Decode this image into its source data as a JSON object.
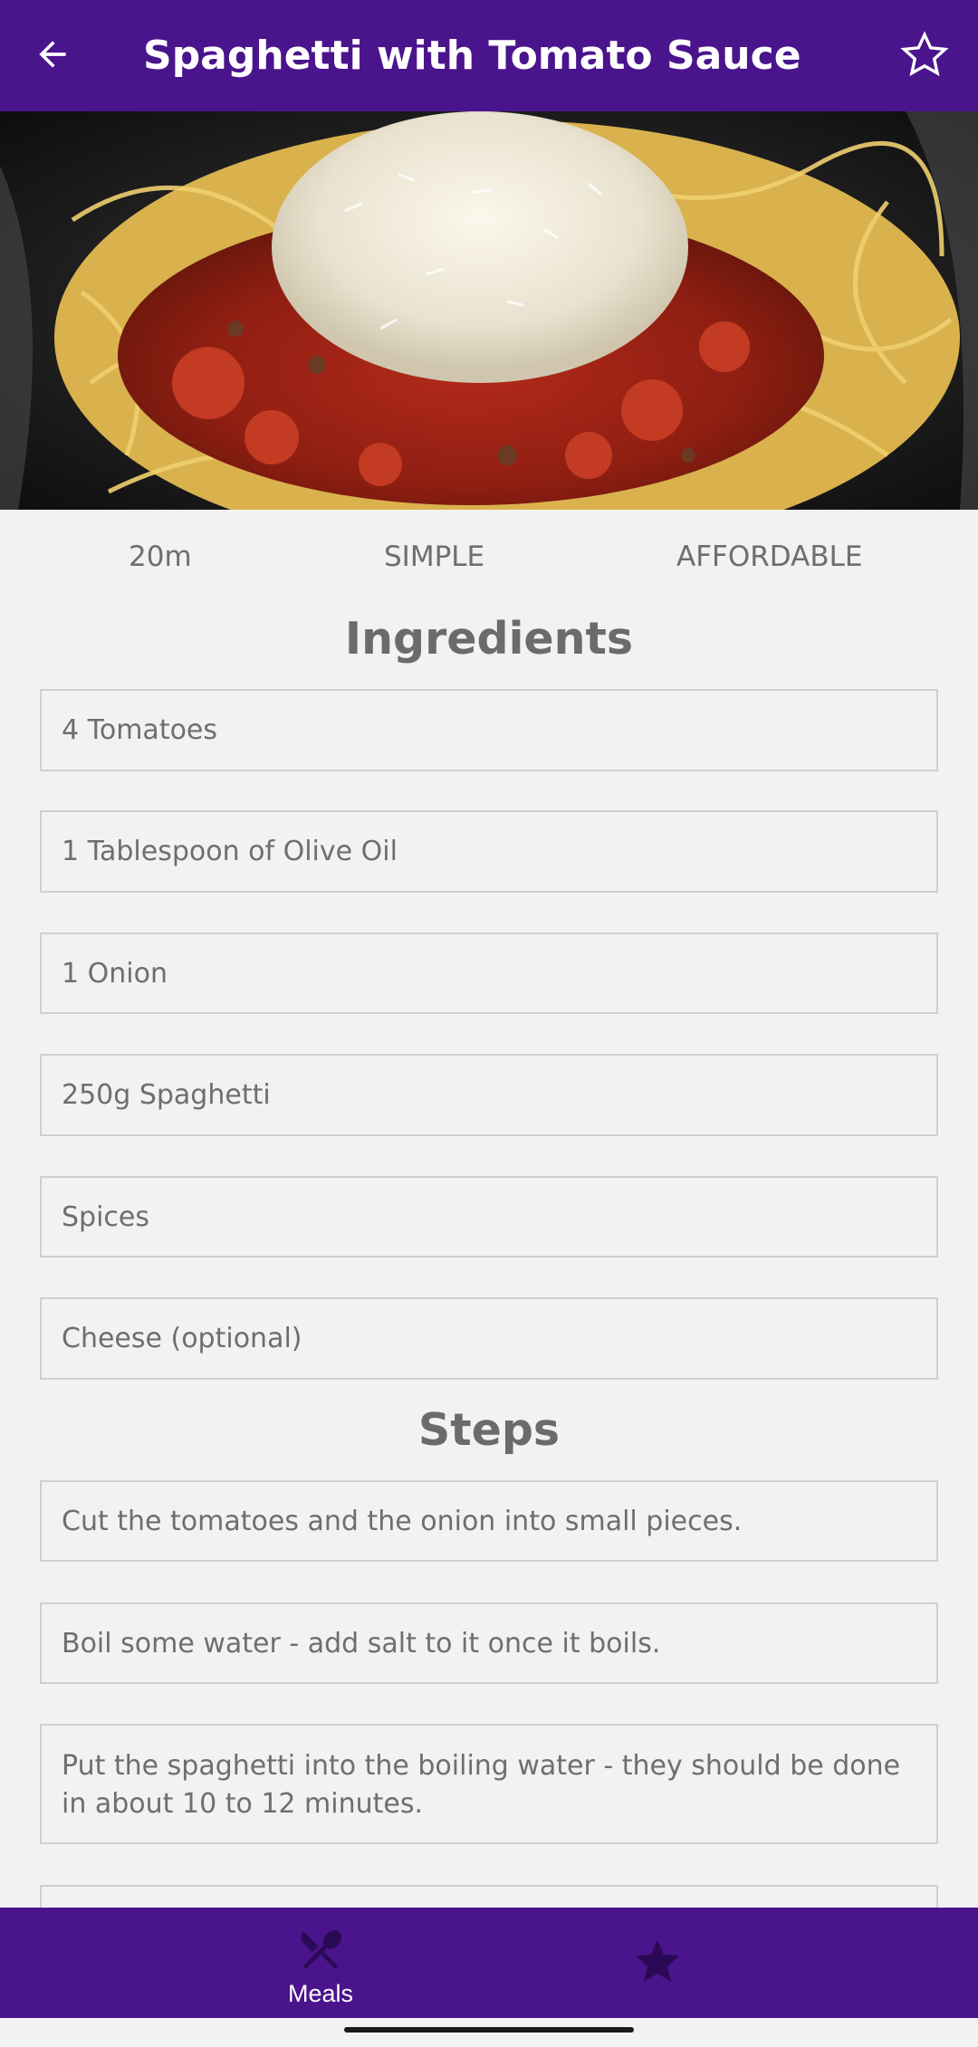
{
  "app_bar": {
    "title": "Spaghetti with Tomato Sauce",
    "back_icon": "arrow-left-icon",
    "favorite_icon": "star-outline-icon",
    "background_color": "#4a148c"
  },
  "meal": {
    "image_alt": "spaghetti-photo",
    "duration": "20m",
    "complexity": "SIMPLE",
    "affordability": "AFFORDABLE"
  },
  "ingredients_section": {
    "title": "Ingredients",
    "items": [
      "4 Tomatoes",
      "1 Tablespoon of Olive Oil",
      "1 Onion",
      "250g Spaghetti",
      "Spices",
      "Cheese (optional)"
    ]
  },
  "steps_section": {
    "title": "Steps",
    "items": [
      "Cut the tomatoes and the onion into small pieces.",
      "Boil some water - add salt to it once it boils.",
      "Put the spaghetti into the boiling water - they should be done in about 10 to 12 minutes."
    ]
  },
  "bottom_nav": {
    "items": [
      {
        "label": "Meals",
        "icon": "cutlery-icon"
      },
      {
        "label": "",
        "icon": "star-filled-icon"
      }
    ],
    "background_color": "#4a148c",
    "inactive_icon_color": "#2a0a55"
  }
}
